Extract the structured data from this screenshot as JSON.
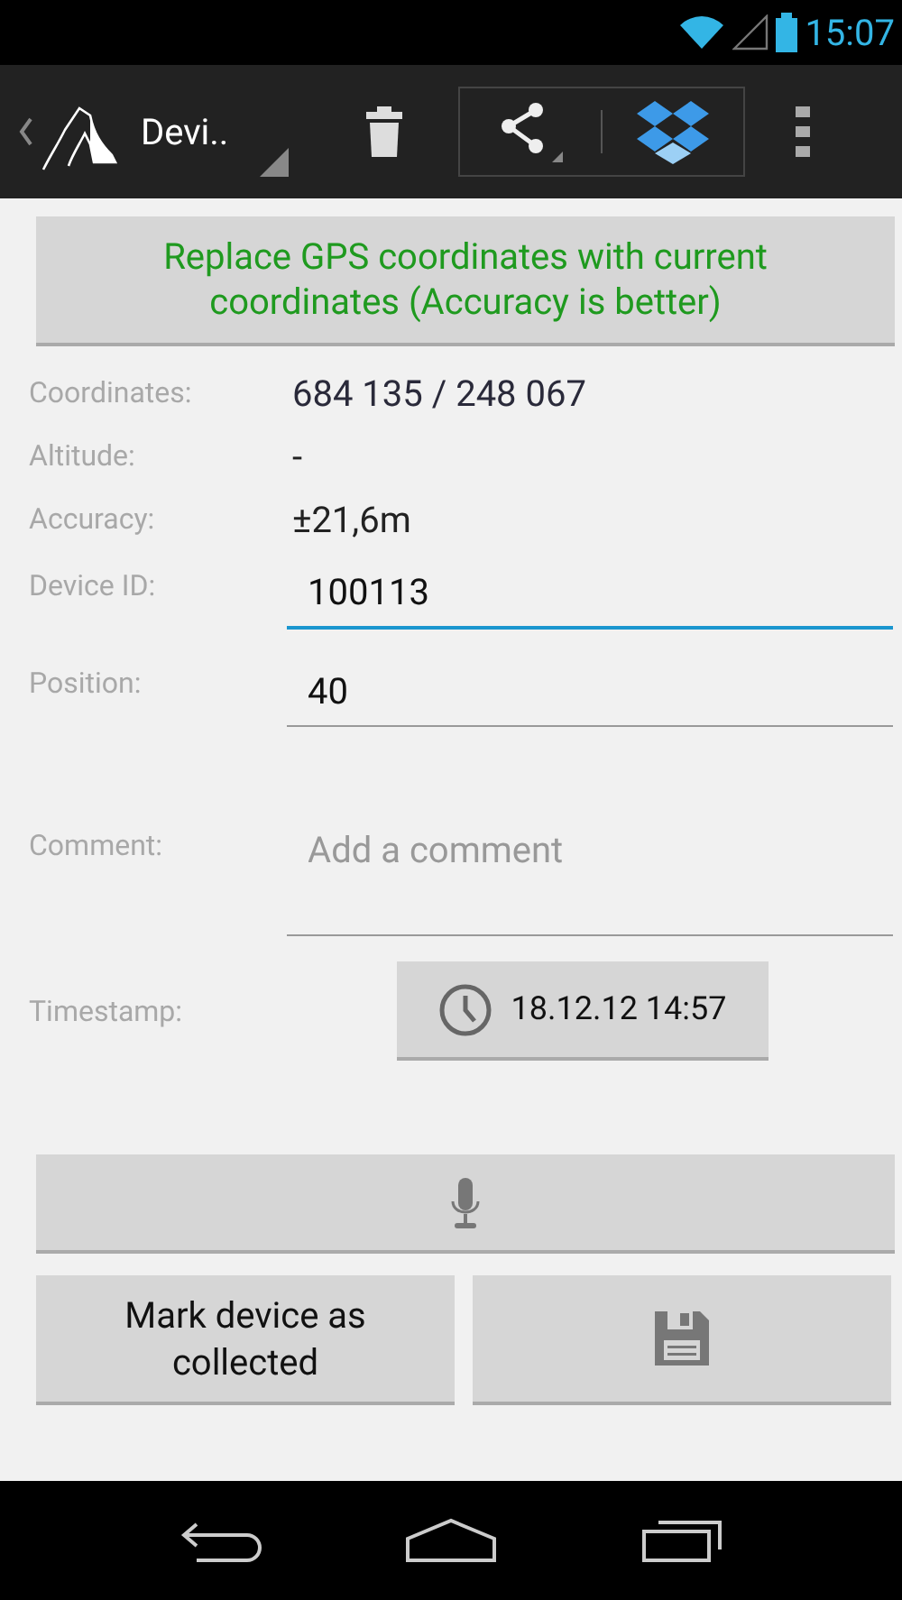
{
  "status_bar": {
    "time": "15:07"
  },
  "action_bar": {
    "title": "Devi.."
  },
  "replace_button": {
    "label": "Replace GPS coordinates with current coordinates (Accuracy is better)"
  },
  "info_rows": [
    {
      "label": "Coordinates:",
      "value": "684 135 / 248 067"
    },
    {
      "label": "Altitude:",
      "value": "-"
    },
    {
      "label": "Accuracy:",
      "value": "±21,6m"
    }
  ],
  "fields": [
    {
      "label": "Device ID:",
      "value": "100113",
      "focused": true
    },
    {
      "label": "Position:",
      "value": "40",
      "focused": false
    },
    {
      "label": "Comment:",
      "placeholder": "Add a comment",
      "focused": false
    }
  ],
  "timestamp": {
    "label": "Timestamp:",
    "value": "18.12.12 14:57"
  },
  "mark_button": {
    "label": "Mark device as collected"
  }
}
